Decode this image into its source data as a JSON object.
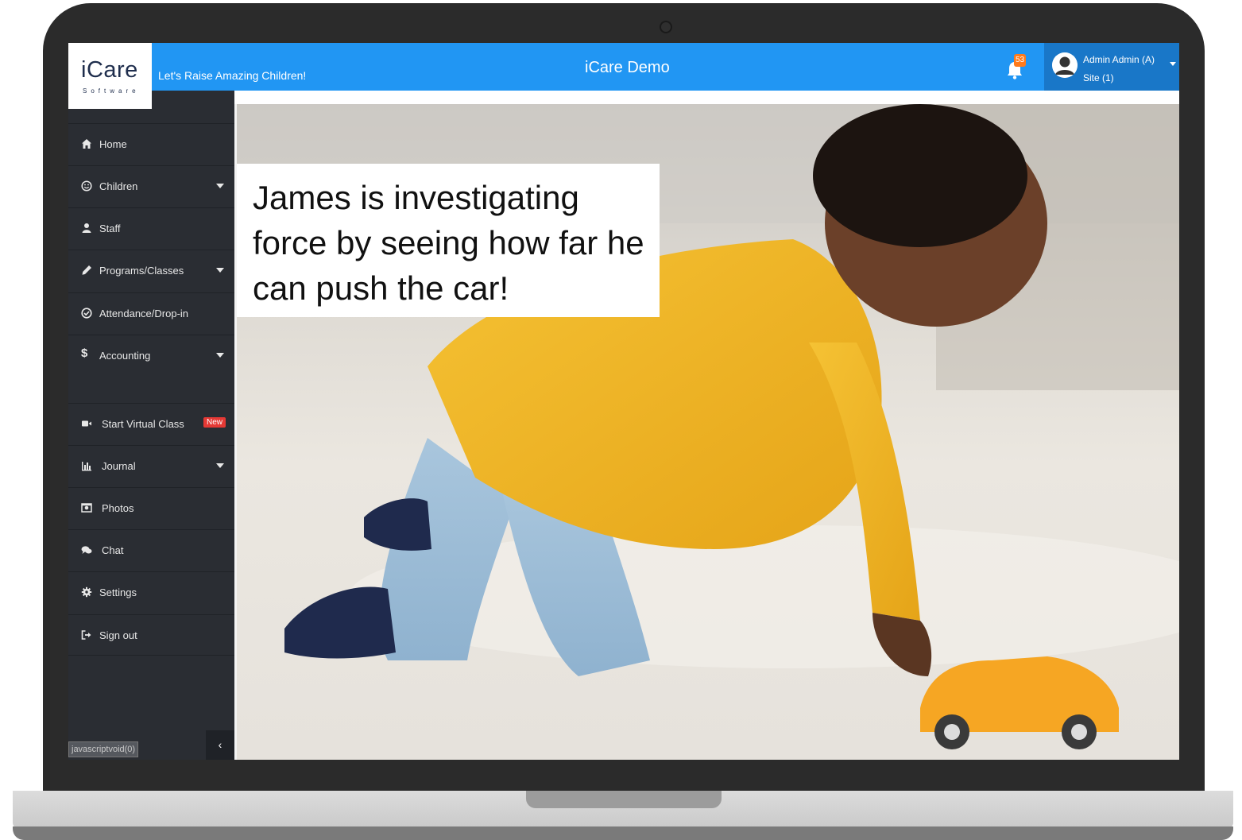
{
  "app": {
    "logo": "iCare",
    "logo_sub": "Software",
    "tagline": "Let's Raise Amazing Children!",
    "title": "iCare Demo"
  },
  "header": {
    "notification_count": "53",
    "user_name": "Admin Admin (A)",
    "user_site": "Site (1)"
  },
  "sidebar": {
    "items": [
      {
        "label": "Home",
        "icon": "home-icon",
        "has_caret": false
      },
      {
        "label": "Children",
        "icon": "smiley-icon",
        "has_caret": true
      },
      {
        "label": "Staff",
        "icon": "user-icon",
        "has_caret": false
      },
      {
        "label": "Programs/Classes",
        "icon": "pencil-icon",
        "has_caret": true
      },
      {
        "label": "Attendance/Drop-in",
        "icon": "check-circle-icon",
        "has_caret": false
      },
      {
        "label": "Accounting",
        "icon": "dollar-icon",
        "has_caret": true
      },
      {
        "label": "Start Virtual Class",
        "icon": "video-icon",
        "badge": "New"
      },
      {
        "label": "Journal",
        "icon": "bar-chart-icon",
        "has_caret": true
      },
      {
        "label": "Photos",
        "icon": "photo-icon",
        "has_caret": false
      },
      {
        "label": "Chat",
        "icon": "chat-icon",
        "has_caret": false
      },
      {
        "label": "Settings",
        "icon": "gear-icon",
        "has_caret": false
      },
      {
        "label": "Sign out",
        "icon": "sign-out-icon",
        "has_caret": false
      }
    ],
    "collapse_label": "‹",
    "status_tip": "javascriptvoid(0)"
  },
  "main": {
    "caption": "James is investigating force by seeing how far he can push the car!"
  },
  "colors": {
    "topbar": "#2196f3",
    "user_area": "#1977c8",
    "sidebar": "#2a2d33",
    "badge_new": "#e53935",
    "notification_badge": "#ff7a1a"
  }
}
